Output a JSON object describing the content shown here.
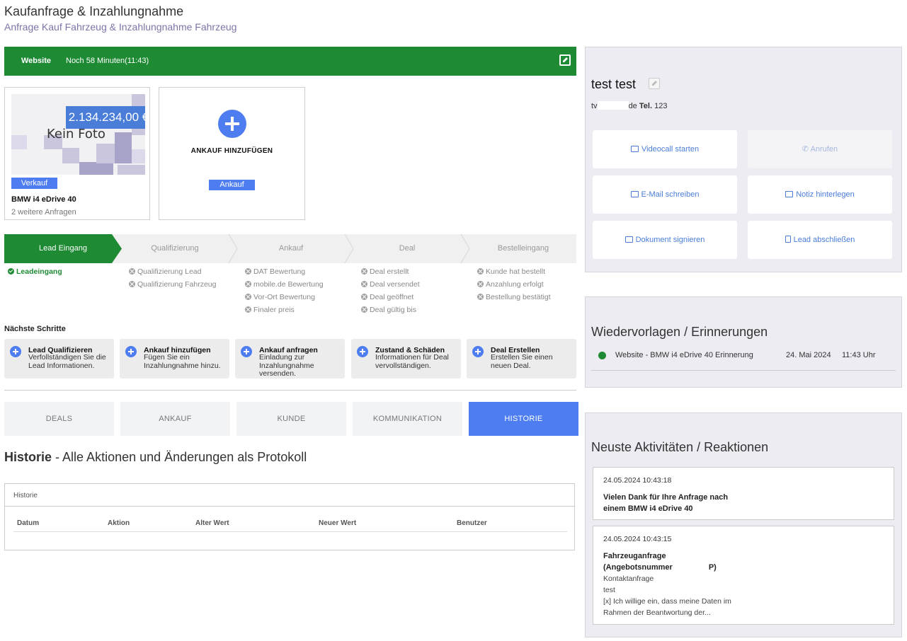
{
  "header": {
    "title": "Kaufanfrage & Inzahlungnahme",
    "subtitle": "Anfrage Kauf Fahrzeug & Inzahlungnahme Fahrzeug"
  },
  "topbar": {
    "source": "Website",
    "timer": "Noch 58 Minuten(11:43)",
    "color": "#1e8a34"
  },
  "vehicle_card": {
    "price": "2.134.234,00 €",
    "photo_placeholder": "Kein Foto",
    "tag": "Verkauf",
    "name": "BMW i4 eDrive 40",
    "more": "2 weitere Anfragen"
  },
  "add_card": {
    "label": "ANKAUF HINZUFÜGEN",
    "tag": "Ankauf"
  },
  "stepper": {
    "steps": [
      "Lead Eingang",
      "Qualifizierung",
      "Ankauf",
      "Deal",
      "Bestelleingang"
    ],
    "active_index": 0
  },
  "checklists": {
    "lead": [
      "Leadeingang"
    ],
    "qualifizierung": [
      "Qualifizierung Lead",
      "Qualifizierung Fahrzeug"
    ],
    "ankauf": [
      "DAT Bewertung",
      "mobile.de Bewertung",
      "Vor-Ort Bewertung",
      "Finaler preis"
    ],
    "deal": [
      "Deal erstellt",
      "Deal versendet",
      "Deal geöffnet",
      "Deal gültig bis"
    ],
    "bestellung": [
      "Kunde hat bestellt",
      "Anzahlung erfolgt",
      "Bestellung bestätigt"
    ]
  },
  "next_steps": {
    "title": "Nächste Schritte",
    "items": [
      {
        "title": "Lead Qualifizieren",
        "desc": "Verfollständigen Sie die Lead Informationen."
      },
      {
        "title": "Ankauf hinzufügen",
        "desc": "Fügen Sie ein Inzahlungnahme hinzu."
      },
      {
        "title": "Ankauf anfragen",
        "desc": "Einladung zur Inzahlungnahme versenden."
      },
      {
        "title": "Zustand & Schäden",
        "desc": "Informationen für Deal vervollständigen."
      },
      {
        "title": "Deal Erstellen",
        "desc": "Erstellen Sie einen neuen Deal."
      }
    ]
  },
  "tabs": [
    "DEALS",
    "ANKAUF",
    "KUNDE",
    "KOMMUNIKATION",
    "HISTORIE"
  ],
  "active_tab": "HISTORIE",
  "history": {
    "title_bold": "Historie",
    "title_rest": " - Alle Aktionen und Änderungen als Protokoll",
    "box_header": "Historie",
    "columns": [
      "Datum",
      "Aktion",
      "Alter Wert",
      "Neuer Wert",
      "Benutzer"
    ]
  },
  "contact": {
    "name": "test test",
    "email_prefix": "tv",
    "email_suffix": "de",
    "tel_label": "Tel.",
    "tel": "123",
    "actions": [
      {
        "label": "Videocall starten",
        "icon": "video-icon",
        "enabled": true
      },
      {
        "label": "Anrufen",
        "icon": "phone-icon",
        "enabled": false
      },
      {
        "label": "E-Mail schreiben",
        "icon": "mail-icon",
        "enabled": true
      },
      {
        "label": "Notiz hinterlegen",
        "icon": "note-icon",
        "enabled": true
      },
      {
        "label": "Dokument signieren",
        "icon": "sign-icon",
        "enabled": true
      },
      {
        "label": "Lead abschließen",
        "icon": "document-icon",
        "enabled": true
      }
    ]
  },
  "reminders": {
    "title": "Wiedervorlagen / Erinnerungen",
    "items": [
      {
        "text": "Website - BMW i4 eDrive 40 Erinnerung",
        "date": "24. Mai 2024",
        "time": "11:43 Uhr"
      }
    ]
  },
  "activities": {
    "title": "Neuste Aktivitäten / Reaktionen",
    "items": [
      {
        "timestamp": "24.05.2024 10:43:18",
        "headline": [
          "Vielen Dank für Ihre Anfrage nach",
          "einem BMW i4 eDrive 40"
        ],
        "lines": []
      },
      {
        "timestamp": "24.05.2024 10:43:15",
        "headline": [
          "Fahrzeuganfrage",
          "(Angebotsnummer",
          "P)"
        ],
        "lines": [
          "Kontaktanfrage",
          "test",
          "[x] Ich willige ein, dass meine Daten im",
          "Rahmen der Beantwortung der..."
        ]
      }
    ]
  },
  "colors": {
    "accent": "#4d7df0",
    "success": "#1e8a34",
    "panel": "#ececf2"
  }
}
